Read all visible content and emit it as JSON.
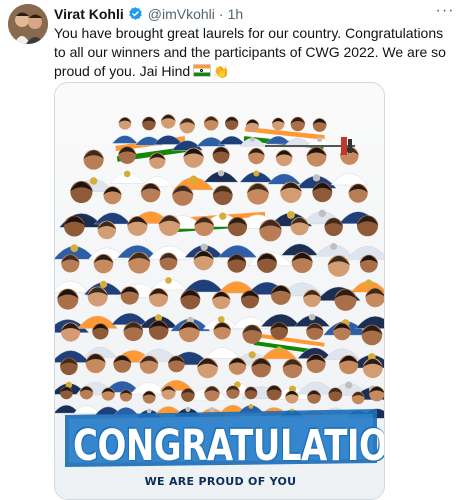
{
  "tweet": {
    "author_name": "Virat Kohli",
    "handle": "@imVkohli",
    "separator": "·",
    "time": "1h",
    "more_icon": "more-horizontal-icon",
    "text": "You have brought great laurels for our country. Congratulations to all our winners and the participants of CWG 2022. We are so proud of you. Jai Hind",
    "emojis": [
      "flag-india",
      "clapping-hands"
    ]
  },
  "media": {
    "headline": "CONGRATULATIONS",
    "subheadline": "WE ARE PROUD OF YOU"
  },
  "colors": {
    "verified_badge": "#1d9bf0",
    "secondary_text": "#536471",
    "banner_blue": "#1d6fb8",
    "flag_saffron": "#ff9933",
    "flag_green": "#138808"
  }
}
